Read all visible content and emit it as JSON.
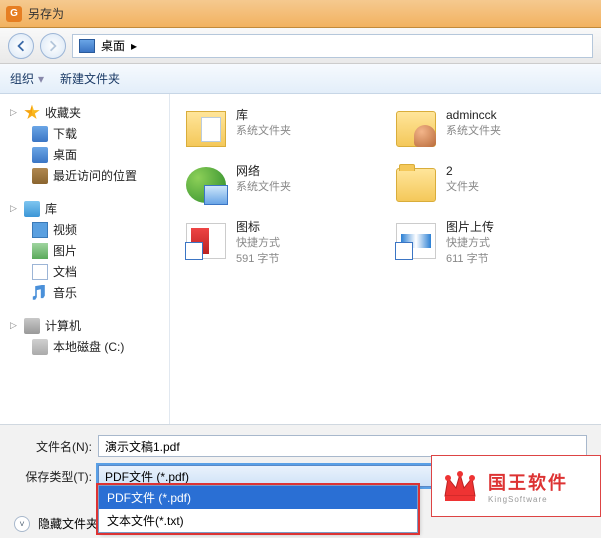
{
  "window": {
    "title": "另存为"
  },
  "nav": {
    "crumb_root": "桌面"
  },
  "toolbar": {
    "organize": "组织",
    "new_folder": "新建文件夹"
  },
  "sidebar": {
    "favorites": "收藏夹",
    "downloads": "下载",
    "desktop": "桌面",
    "recent": "最近访问的位置",
    "libraries": "库",
    "videos": "视频",
    "pictures": "图片",
    "documents": "文档",
    "music": "音乐",
    "computer": "计算机",
    "local_disk": "本地磁盘 (C:)"
  },
  "content": {
    "items": [
      {
        "name": "库",
        "sub1": "系统文件夹",
        "sub2": ""
      },
      {
        "name": "admincck",
        "sub1": "系统文件夹",
        "sub2": ""
      },
      {
        "name": "网络",
        "sub1": "系统文件夹",
        "sub2": ""
      },
      {
        "name": "2",
        "sub1": "文件夹",
        "sub2": ""
      },
      {
        "name": "图标",
        "sub1": "快捷方式",
        "sub2": "591 字节"
      },
      {
        "name": "图片上传",
        "sub1": "快捷方式",
        "sub2": "611 字节"
      }
    ]
  },
  "fields": {
    "filename_label": "文件名(N):",
    "filename_value": "演示文稿1.pdf",
    "type_label": "保存类型(T):",
    "type_selected": "PDF文件 (*.pdf)",
    "type_options": [
      "PDF文件 (*.pdf)",
      "文本文件(*.txt)"
    ],
    "hide_folders": "隐藏文件夹"
  },
  "watermark": {
    "text": "国王软件",
    "sub": "KingSoftware"
  }
}
